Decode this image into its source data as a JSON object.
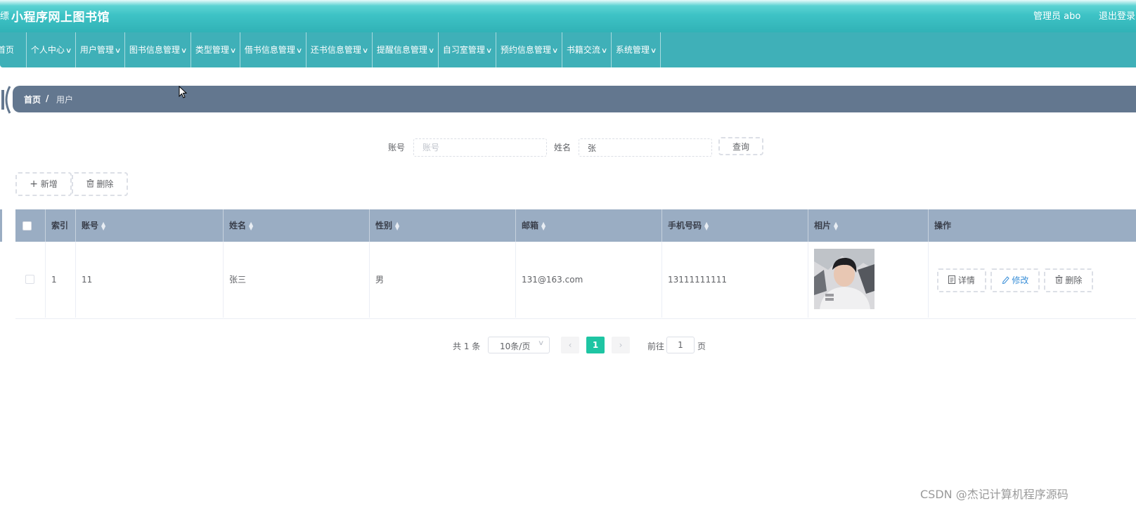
{
  "header": {
    "edge_glyph": "缥",
    "app_title": "小程序网上图书馆",
    "user_label": "管理员 abo",
    "logout_label": "退出登录"
  },
  "nav": {
    "items": [
      {
        "label": "首页",
        "has_menu": false
      },
      {
        "label": "个人中心",
        "has_menu": true
      },
      {
        "label": "用户管理",
        "has_menu": true
      },
      {
        "label": "图书信息管理",
        "has_menu": true
      },
      {
        "label": "类型管理",
        "has_menu": true
      },
      {
        "label": "借书信息管理",
        "has_menu": true
      },
      {
        "label": "还书信息管理",
        "has_menu": true
      },
      {
        "label": "提醒信息管理",
        "has_menu": true
      },
      {
        "label": "自习室管理",
        "has_menu": true
      },
      {
        "label": "预约信息管理",
        "has_menu": true
      },
      {
        "label": "书籍交流",
        "has_menu": true
      },
      {
        "label": "系统管理",
        "has_menu": true
      }
    ]
  },
  "breadcrumb": {
    "home": "首页",
    "separator": "/",
    "current": "用户"
  },
  "search": {
    "account_label": "账号",
    "account_placeholder": "账号",
    "account_value": "",
    "name_label": "姓名",
    "name_value": "张",
    "query_button": "查询"
  },
  "toolbar": {
    "add_label": "新增",
    "delete_label": "删除"
  },
  "table": {
    "headers": {
      "index": "索引",
      "account": "账号",
      "name": "姓名",
      "gender": "性别",
      "email": "邮箱",
      "phone": "手机号码",
      "photo": "相片",
      "actions": "操作"
    },
    "rows": [
      {
        "index": "1",
        "account": "11",
        "name": "张三",
        "gender": "男",
        "email": "131@163.com",
        "phone": "13111111111"
      }
    ],
    "row_actions": {
      "detail": "详情",
      "edit": "修改",
      "delete": "删除"
    }
  },
  "pagination": {
    "total_text": "共 1 条",
    "page_size": "10条/页",
    "current_page": "1",
    "goto_label": "前往",
    "goto_value": "1",
    "page_suffix": "页"
  },
  "watermark": "CSDN @杰记计算机程序源码",
  "colors": {
    "header": "#3ec3c6",
    "nav": "#3fb0b8",
    "breadcrumb": "#63778f",
    "table_head": "#9aadc3",
    "pager_active": "#1ec5a3"
  }
}
